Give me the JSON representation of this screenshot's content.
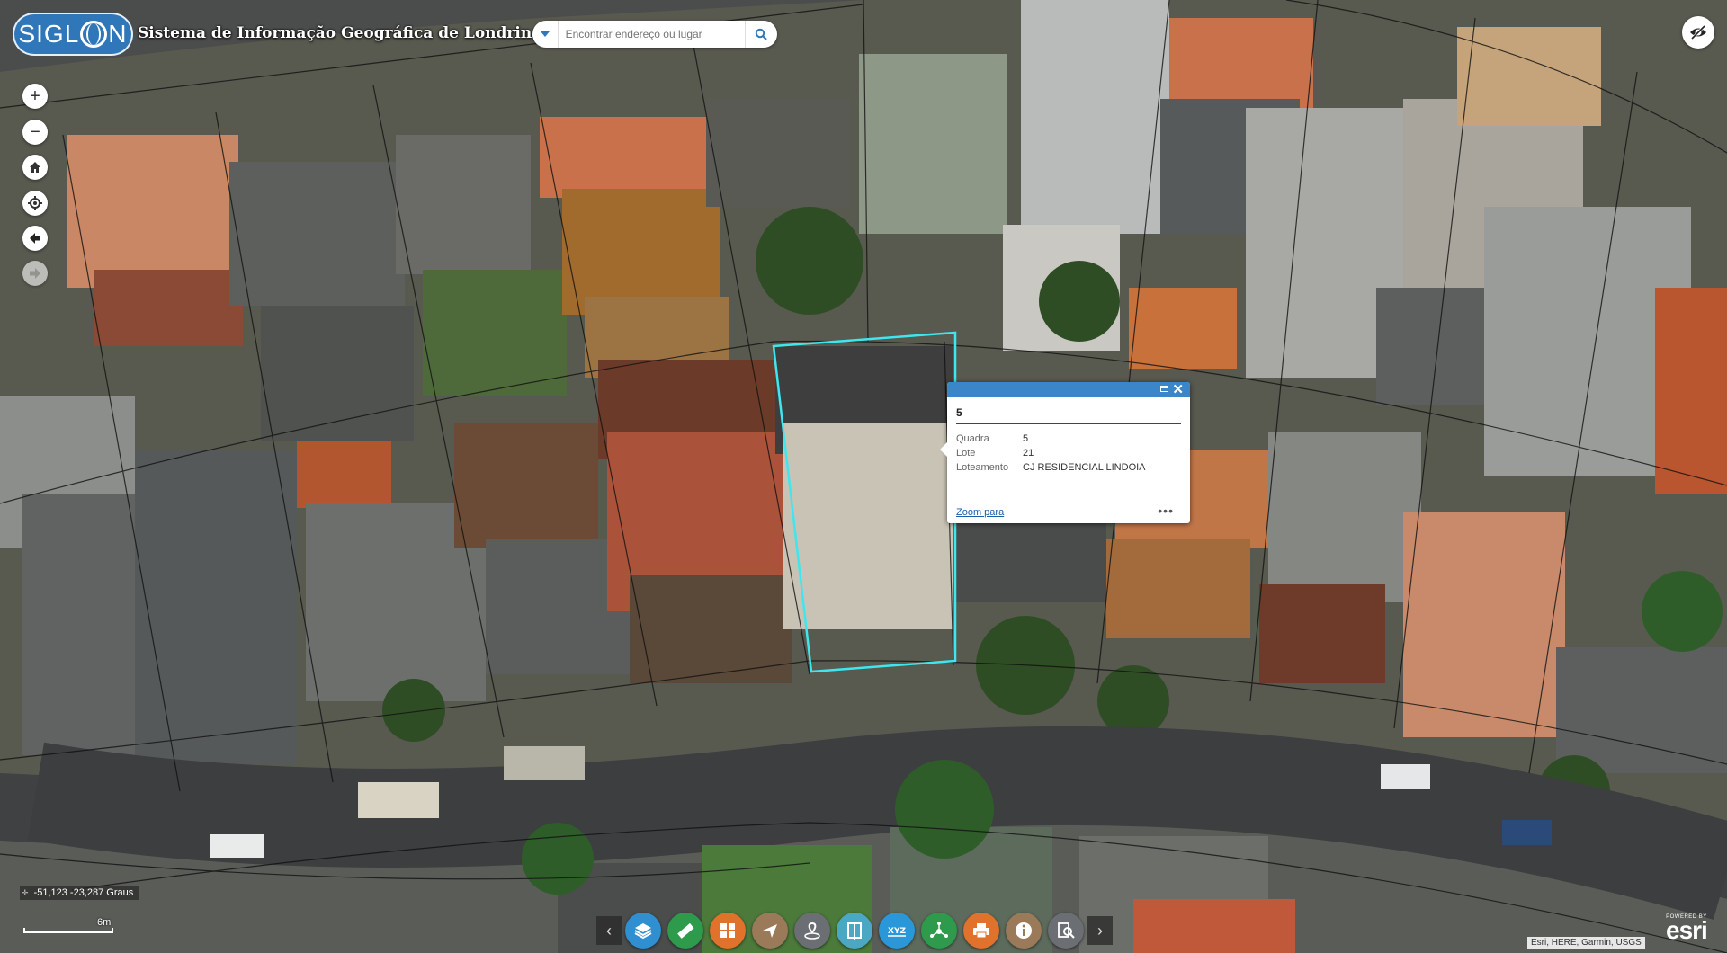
{
  "header": {
    "logo_text": "SIGLON",
    "title": "Sistema de Informação Geográfica de Londrina",
    "search_placeholder": "Encontrar endereço ou lugar"
  },
  "nav": {
    "zoom_in": "+",
    "zoom_out": "−"
  },
  "popup": {
    "title": "5",
    "fields": [
      {
        "label": "Quadra",
        "value": "5"
      },
      {
        "label": "Lote",
        "value": "21"
      },
      {
        "label": "Loteamento",
        "value": "CJ RESIDENCIAL LINDOIA"
      }
    ],
    "zoom_link": "Zoom para",
    "more": "•••"
  },
  "toolbar": {
    "prev": "‹",
    "next": "›",
    "tools": [
      {
        "name": "layers-tool",
        "color": "#2f8fd0"
      },
      {
        "name": "measure-tool",
        "color": "#2e9a4c"
      },
      {
        "name": "basemap-gallery-tool",
        "color": "#e0722b"
      },
      {
        "name": "directions-tool",
        "color": "#9b7a5a"
      },
      {
        "name": "locate-tool",
        "color": "#6b6f73"
      },
      {
        "name": "swipe-tool",
        "color": "#4aa8c4"
      },
      {
        "name": "xyz-tool",
        "color": "#2a98d8"
      },
      {
        "name": "share-tool",
        "color": "#2e9a4c"
      },
      {
        "name": "print-tool",
        "color": "#e0722b"
      },
      {
        "name": "about-tool",
        "color": "#9b7a5a"
      },
      {
        "name": "query-tool",
        "color": "#6b6f73"
      }
    ]
  },
  "status": {
    "coordinates": "-51,123 -23,287 Graus",
    "scale_label": "6m",
    "attribution": "Esri, HERE, Garmin, USGS",
    "esri_powered": "POWERED BY",
    "esri_name": "esri"
  },
  "colors": {
    "accent": "#3a86c8",
    "selection": "#3ee6ee"
  }
}
